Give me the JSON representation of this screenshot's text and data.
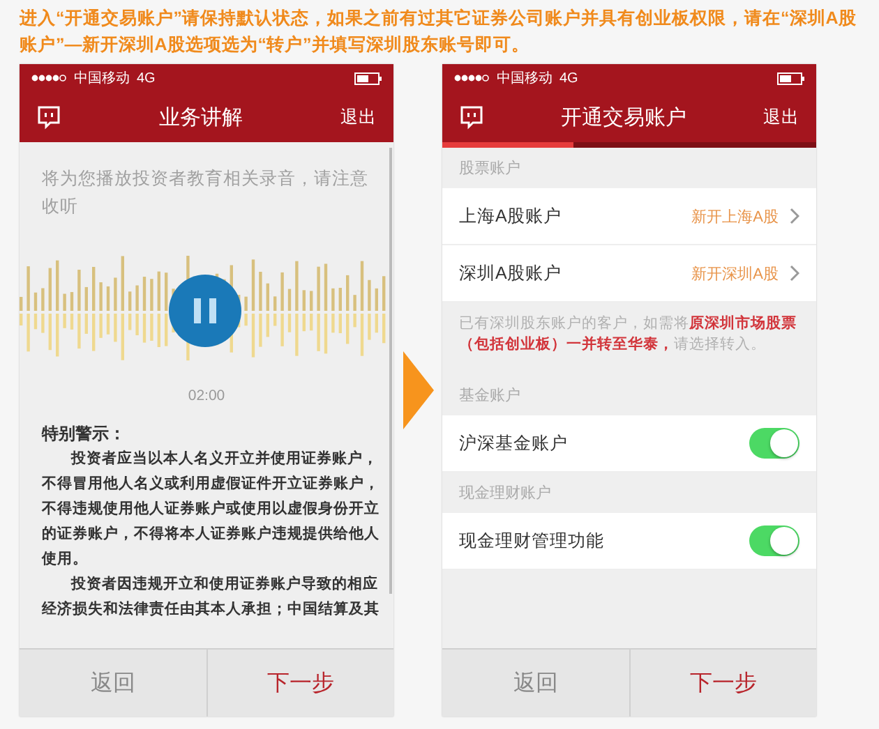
{
  "caption": "进入“开通交易账户”请保持默认状态，如果之前有过其它证券公司账户并具有创业板权限，请在“深圳A股账户”—新开深圳A股选项选为“转户”并填写深圳股东账号即可。",
  "left_screen": {
    "status_bar": {
      "carrier": "中国移动",
      "network": "4G"
    },
    "nav": {
      "title": "业务讲解",
      "action": "退出"
    },
    "intro": "将为您播放投资者教育相关录音，请注意收听",
    "player": {
      "playing": true,
      "time": "02:00"
    },
    "warning": {
      "title": "特别警示：",
      "paragraphs": [
        "投资者应当以本人名义开立并使用证券账户，不得冒用他人名义或利用虚假证件开立证券账户，不得违规使用他人证券账户或使用以虚假身份开立的证券账户，不得将本人证券账户违规提供给他人使用。",
        "投资者因违规开立和使用证券账户导致的相应经济损失和法律责任由其本人承担；中国结算及其"
      ]
    },
    "buttons": [
      "返回",
      "下一步"
    ]
  },
  "right_screen": {
    "status_bar": {
      "carrier": "中国移动",
      "network": "4G"
    },
    "nav": {
      "title": "开通交易账户",
      "action": "退出"
    },
    "progress": {
      "level": 0.35
    },
    "sections": [
      {
        "header": "股票账户",
        "rows": [
          {
            "kind": "link",
            "label": "上海A股账户",
            "value": "新开上海A股"
          },
          {
            "kind": "link",
            "label": "深圳A股账户",
            "value": "新开深圳A股"
          }
        ],
        "note": "已有深圳股东账户的客户，如需将**原深圳市场股票（包括创业板）一并转至华泰，**请选择转入。"
      },
      {
        "header": "基金账户",
        "rows": [
          {
            "kind": "toggle",
            "label": "沪深基金账户",
            "on": true
          }
        ]
      },
      {
        "header": "现金理财账户",
        "rows": [
          {
            "kind": "toggle",
            "label": "现金理财管理功能",
            "on": true
          }
        ]
      }
    ],
    "buttons": [
      "返回",
      "下一步"
    ]
  }
}
